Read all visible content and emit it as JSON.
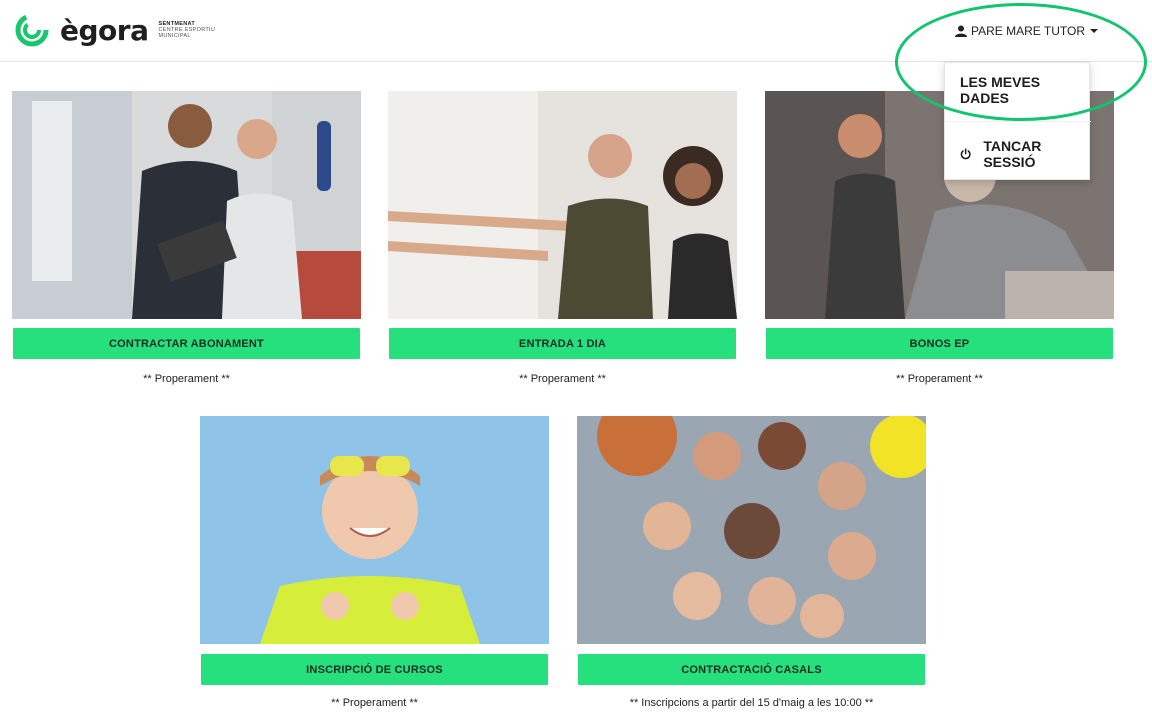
{
  "header": {
    "logo_word": "ègora",
    "logo_sub": [
      "SENTMENAT",
      "CENTRE ESPORTIU",
      "MUNICIPAL"
    ],
    "user_label": "PARE MARE TUTOR"
  },
  "user_dropdown": {
    "items": [
      {
        "label": "LES MEVES DADES"
      },
      {
        "label": "TANCAR SESSIÓ"
      }
    ]
  },
  "cards": [
    {
      "label": "CONTRACTAR ABONAMENT",
      "note": "** Properament **"
    },
    {
      "label": "ENTRADA 1 DIA",
      "note": "** Properament **"
    },
    {
      "label": "BONOS EP",
      "note": "** Properament **"
    },
    {
      "label": "INSCRIPCIÓ DE CURSOS",
      "note": "** Properament **"
    },
    {
      "label": "CONTRACTACIÓ CASALS",
      "note": "** Inscripcions a partir del 15 d'maig a les 10:00 **"
    }
  ],
  "colors": {
    "accent": "#25e07c",
    "highlight": "#11c46f"
  }
}
